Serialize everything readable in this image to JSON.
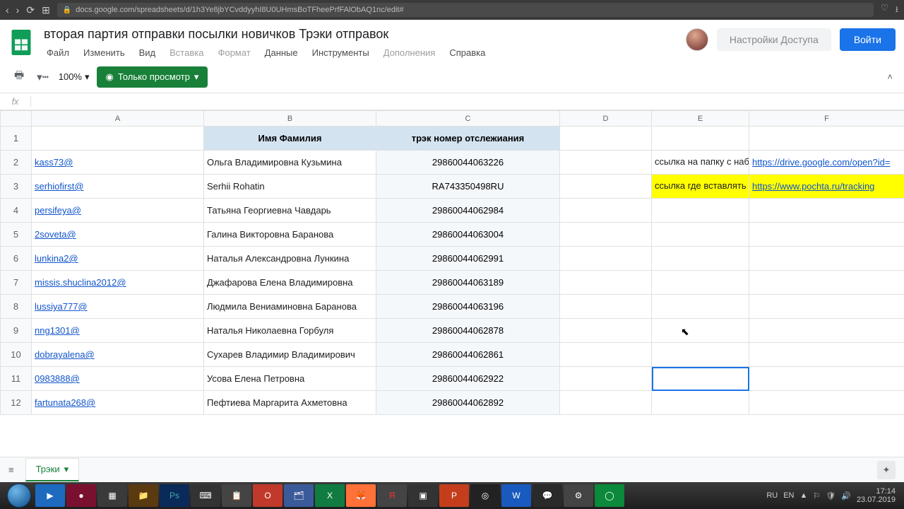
{
  "browser": {
    "url": "docs.google.com/spreadsheets/d/1h3Ye8jbYCvddyyhI8U0UHmsBoTFheePrfFAlObAQ1nc/edit#"
  },
  "doc": {
    "title": "вторая партия отправки посылки новичков Трэки отправок"
  },
  "menu": {
    "file": "Файл",
    "edit": "Изменить",
    "view": "Вид",
    "insert": "Вставка",
    "format": "Формат",
    "data": "Данные",
    "tools": "Инструменты",
    "addons": "Дополнения",
    "help": "Справка"
  },
  "toolbar": {
    "zoom": "100%",
    "view_only": "Только просмотр"
  },
  "header_buttons": {
    "share": "Настройки Доступа",
    "login": "Войти"
  },
  "formula": {
    "fx": "fx",
    "value": ""
  },
  "columns": [
    "A",
    "B",
    "C",
    "D",
    "E",
    "F"
  ],
  "headers": {
    "B": "Имя Фамилия",
    "C": "трэк номер отслежиания"
  },
  "side_notes": {
    "r2_E": "ссылка на папку с набором",
    "r2_F": "https://drive.google.com/open?id=",
    "r3_E": "ссылка где вставлять трек код",
    "r3_F": "https://www.pochta.ru/tracking"
  },
  "rows": [
    {
      "n": "1",
      "A": "",
      "B_header": true,
      "C_header": true
    },
    {
      "n": "2",
      "A": "kass73@",
      "B": "Ольга Владимировна Кузьмина",
      "C": "29860044063226"
    },
    {
      "n": "3",
      "A": "serhiofirst@",
      "B": "Serhii Rohatin",
      "C": "RA743350498RU"
    },
    {
      "n": "4",
      "A": "persifeya@",
      "B": "Татьяна Георгиевна Чавдарь",
      "C": "29860044062984"
    },
    {
      "n": "5",
      "A": "2soveta@",
      "B": "Галина Викторовна Баранова",
      "C": "29860044063004"
    },
    {
      "n": "6",
      "A": "lunkina2@",
      "B": "Наталья Александровна Лункина",
      "C": "29860044062991"
    },
    {
      "n": "7",
      "A": "missis.shuclina2012@",
      "B": "Джафарова Елена Владимировна",
      "C": "29860044063189"
    },
    {
      "n": "8",
      "A": "lussiya777@",
      "B": "Людмила Вениаминовна Баранова",
      "C": "29860044063196"
    },
    {
      "n": "9",
      "A": "nng1301@",
      "B": "Наталья Николаевна Горбуля",
      "C": "29860044062878"
    },
    {
      "n": "10",
      "A": "dobrayalena@",
      "B": "Сухарев Владимир Владимирович",
      "C": "29860044062861"
    },
    {
      "n": "11",
      "A": "0983888@",
      "B": "Усова Елена Петровна",
      "C": "29860044062922"
    },
    {
      "n": "12",
      "A": "fartunata268@",
      "B": "Пефтиева Маргарита Ахметовна",
      "C": "29860044062892"
    }
  ],
  "sheet_tab": "Трэки",
  "tray": {
    "lang1": "RU",
    "lang2": "EN",
    "time": "17:14",
    "date": "23.07.2019"
  }
}
